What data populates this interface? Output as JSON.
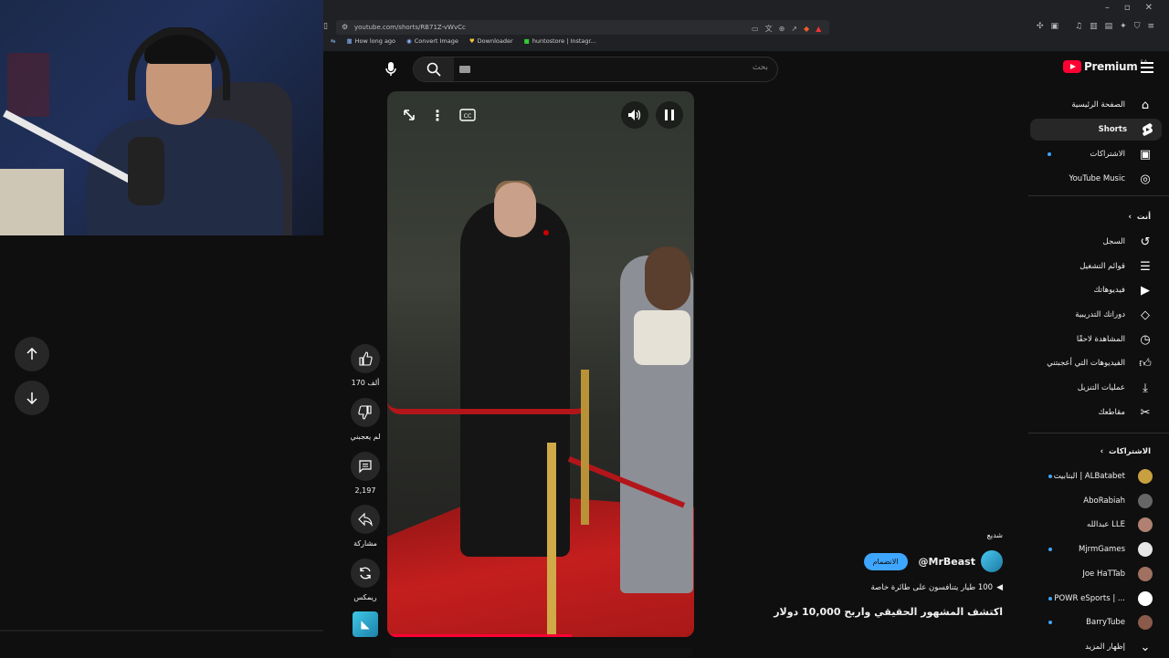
{
  "browser": {
    "url": "youtube.com/shorts/RB71Z-vWvCc",
    "bookmarks": [
      "How long ago",
      "Convert Image",
      "Downloader",
      "huntostore | Instagr..."
    ],
    "window_controls": [
      "–",
      "▫",
      "✕"
    ]
  },
  "search": {
    "placeholder": "بحث"
  },
  "logo": {
    "text": "Premium",
    "region": "SA"
  },
  "video": {
    "progress_fraction": 0.6
  },
  "actions": {
    "like": "170 ألف",
    "dislike": "لم يعجبني",
    "comments": "2,197",
    "share": "مشاركة",
    "remix": "ريمكس"
  },
  "meta": {
    "label": "شديع",
    "channel": "@MrBeast",
    "subscribe": "الانضمام",
    "track": "100 طيار يتنافسون على طائرة خاصة",
    "title": "اكتشف المشهور الحقيقي واربح 10,000 دولار"
  },
  "sidebar": {
    "main": [
      {
        "label": "الصفحة الرئيسية",
        "icon": "home-icon"
      },
      {
        "label": "Shorts",
        "icon": "shorts-icon"
      },
      {
        "label": "الاشتراكات",
        "icon": "subscriptions-icon"
      },
      {
        "label": "YouTube Music",
        "icon": "music-icon"
      }
    ],
    "you_header": "أنت",
    "you": [
      {
        "label": "السجل",
        "icon": "history-icon"
      },
      {
        "label": "قوائم التشغيل",
        "icon": "playlists-icon"
      },
      {
        "label": "فيديوهاتك",
        "icon": "your-videos-icon"
      },
      {
        "label": "دوراتك التدريبية",
        "icon": "courses-icon"
      },
      {
        "label": "المشاهدة لاحقًا",
        "icon": "watch-later-icon"
      },
      {
        "label": "الفيديوهات التي أعجبتني",
        "icon": "liked-icon"
      },
      {
        "label": "عمليات التنزيل",
        "icon": "download-icon"
      },
      {
        "label": "مقاطعك",
        "icon": "clips-icon"
      }
    ],
    "subs_header": "الاشتراكات",
    "subs": [
      {
        "label": "البتابيت | ALBatabet",
        "color": "#c8a040"
      },
      {
        "label": "AboRabiah",
        "color": "#666666"
      },
      {
        "label": "عبدالله LLE",
        "color": "#b08070"
      },
      {
        "label": "MjrmGames",
        "color": "#e6e6e6"
      },
      {
        "label": "Joe HaTTab",
        "color": "#a07060"
      },
      {
        "label": "POWR eSports | ...",
        "color": "#ffffff"
      },
      {
        "label": "BarryTube",
        "color": "#8a5a4a"
      }
    ],
    "show_more": "إظهار المزيد"
  }
}
